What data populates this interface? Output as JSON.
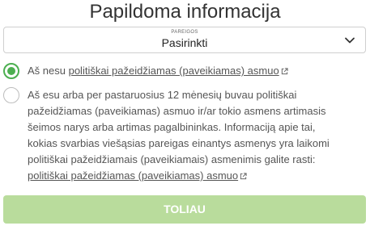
{
  "title": "Papildoma informacija",
  "select": {
    "small_label": "PAREIGOS",
    "value": "Pasirinkti"
  },
  "options": [
    {
      "text_before": "Aš nesu ",
      "link": "politiškai pažeidžiamas (paveikiamas) asmuo",
      "checked": true
    },
    {
      "text_before": "Aš esu arba per pastaruosius 12 mėnesių buvau politiškai pažeidžiamas (paveikiamas) asmuo ir/ar tokio asmens artimasis šeimos narys arba artimas pagalbininkas. Informaciją apie tai, kokias svarbias viešąsias pareigas einantys asmenys yra laikomi politiškai pažeidžiamais (paveikiamais) asmenimis galite rasti: ",
      "link": "politiškai pažeidžiamas (paveikiamas) asmuo",
      "checked": false
    }
  ],
  "submit_label": "TOLIAU",
  "colors": {
    "accent": "#4caf50",
    "button_disabled": "#b9dc9c"
  },
  "icons": {
    "select": "chevron-down-icon",
    "link": "external-link-icon"
  }
}
